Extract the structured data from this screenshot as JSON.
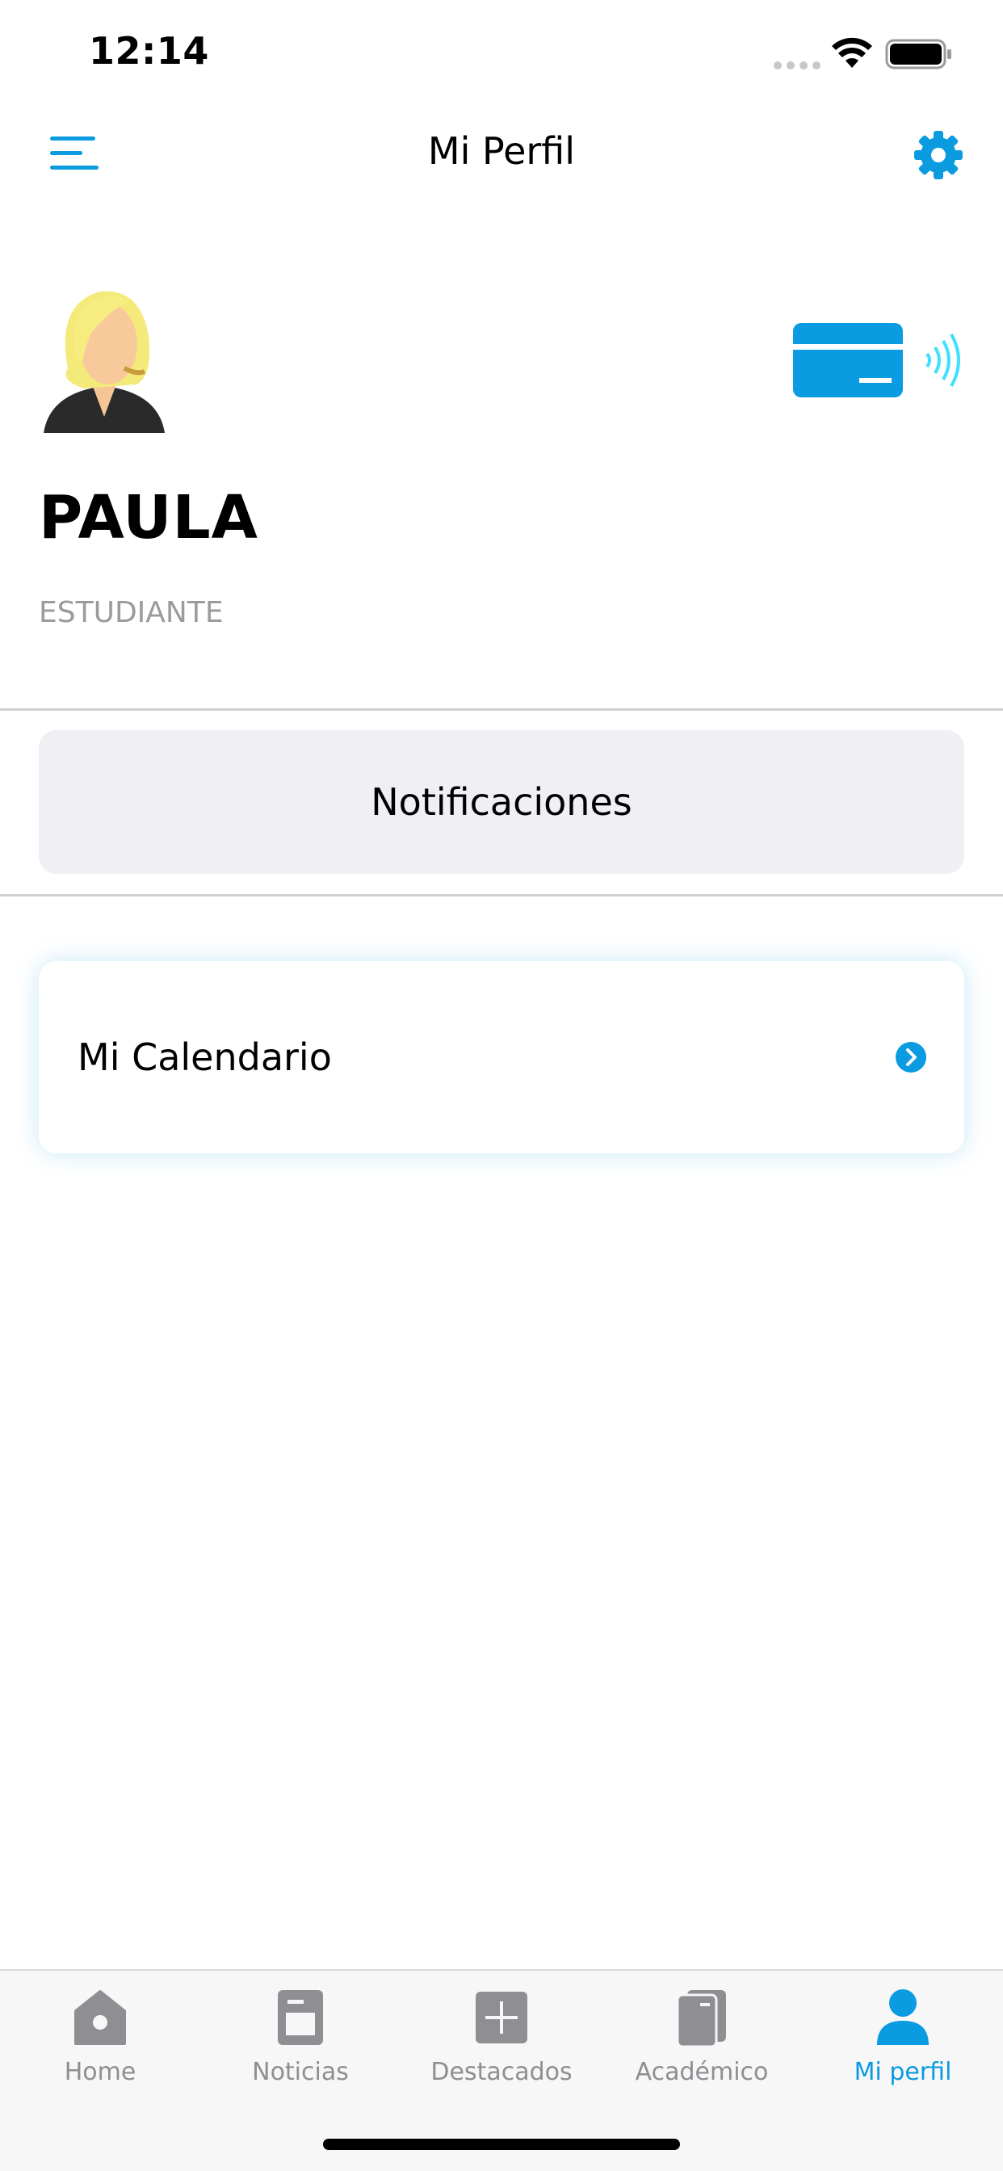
{
  "status_bar": {
    "time": "12:14"
  },
  "nav": {
    "title": "Mi Perfil",
    "menu_icon": "hamburger-menu-icon",
    "settings_icon": "gear-icon"
  },
  "profile": {
    "name": "PAULA",
    "role": "ESTUDIANTE",
    "avatar_icon": "female-avatar",
    "card_icon": "contactless-card-icon"
  },
  "notifications": {
    "label": "Notificaciones"
  },
  "calendar": {
    "label": "Mi Calendario",
    "chevron_icon": "chevron-right-circle-icon"
  },
  "tabs": [
    {
      "label": "Home",
      "icon": "home-icon",
      "active": false
    },
    {
      "label": "Noticias",
      "icon": "news-icon",
      "active": false
    },
    {
      "label": "Destacados",
      "icon": "plus-square-icon",
      "active": false
    },
    {
      "label": "Académico",
      "icon": "book-icon",
      "active": false
    },
    {
      "label": "Mi perfil",
      "icon": "user-icon",
      "active": true
    }
  ],
  "colors": {
    "accent": "#0A9BE0",
    "inactive": "#8E8E93",
    "button_bg": "#EFEFF4"
  }
}
